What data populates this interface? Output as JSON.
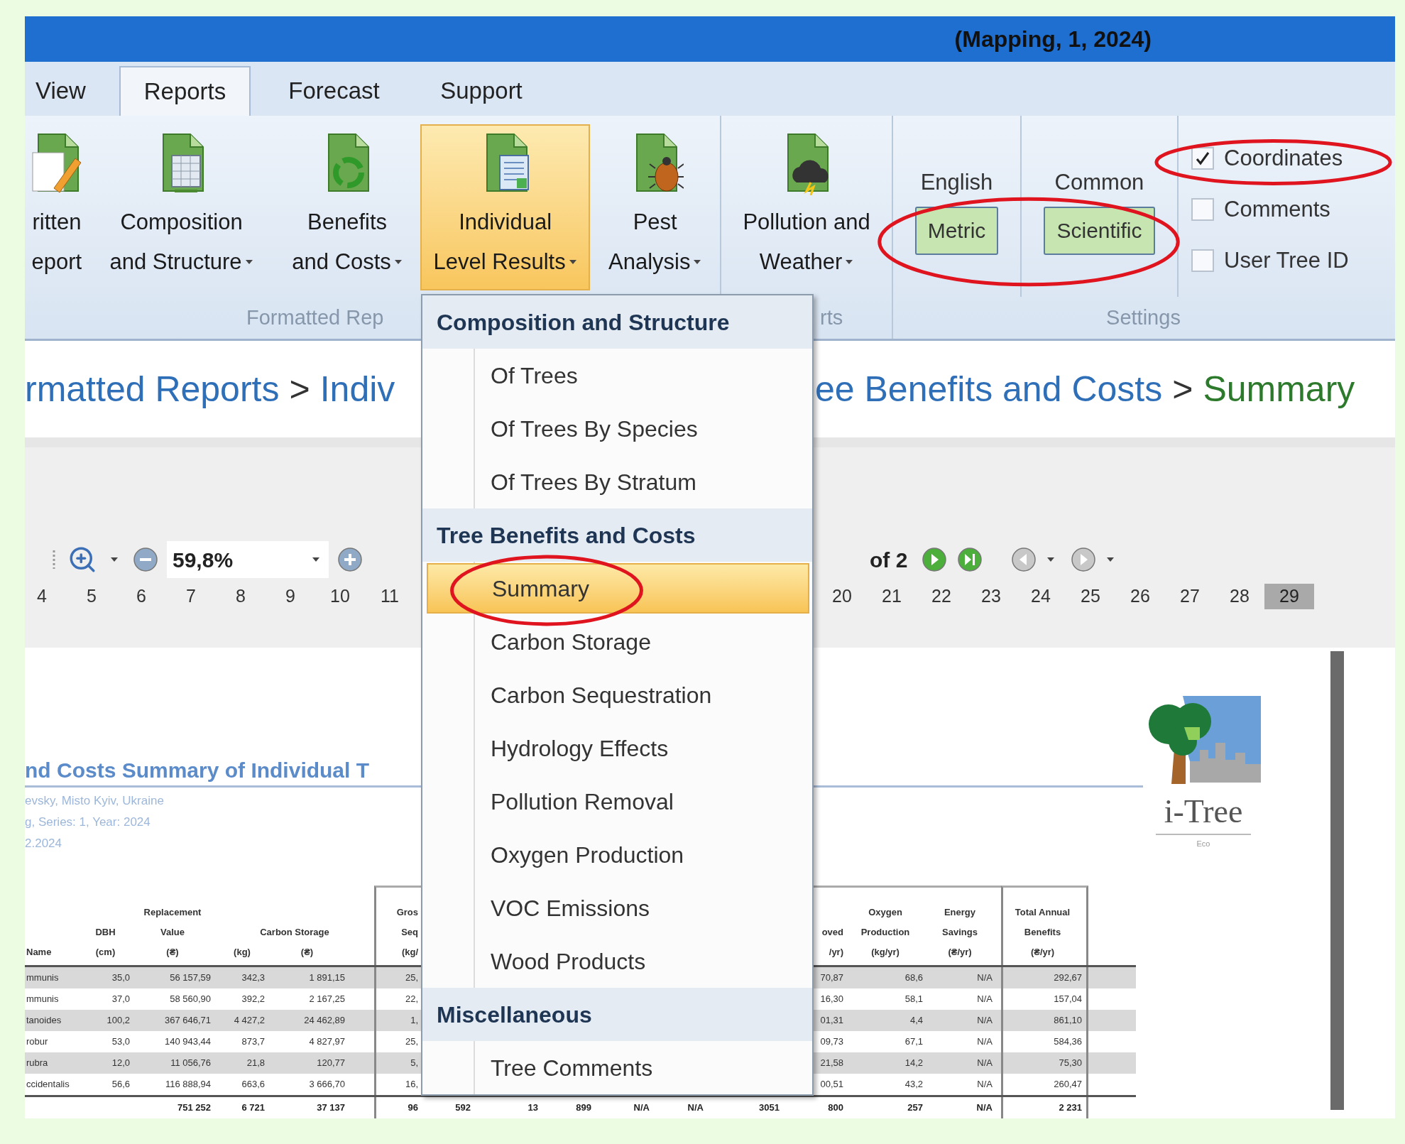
{
  "window": {
    "title": "(Mapping, 1, 2024)"
  },
  "tabs": [
    {
      "label": "View",
      "selected": false
    },
    {
      "label": "Reports",
      "selected": true
    },
    {
      "label": "Forecast",
      "selected": false
    },
    {
      "label": "Support",
      "selected": false
    }
  ],
  "ribbon": {
    "groups": [
      {
        "label": "Formatted Rep",
        "buttons": [
          {
            "lines": [
              "ritten",
              "eport"
            ],
            "dropdown": false,
            "selected": false
          },
          {
            "lines": [
              "Composition",
              "and Structure"
            ],
            "dropdown": true,
            "selected": false
          },
          {
            "lines": [
              "Benefits",
              "and Costs"
            ],
            "dropdown": true,
            "selected": false
          },
          {
            "lines": [
              "Individual",
              "Level Results"
            ],
            "dropdown": true,
            "selected": true
          },
          {
            "lines": [
              "Pest",
              "Analysis"
            ],
            "dropdown": true,
            "selected": false
          }
        ]
      },
      {
        "label": "rts",
        "buttons": [
          {
            "lines": [
              "Pollution and",
              "Weather"
            ],
            "dropdown": true,
            "selected": false
          }
        ]
      }
    ],
    "settings": {
      "label": "Settings",
      "toggles": [
        {
          "caption": "English",
          "option": "Metric",
          "selected": true
        },
        {
          "caption": "Common",
          "option": "Scientific",
          "selected": true
        }
      ],
      "checkboxes": [
        {
          "label": "Coordinates",
          "checked": true
        },
        {
          "label": "Comments",
          "checked": false
        },
        {
          "label": "User Tree ID",
          "checked": false
        }
      ]
    }
  },
  "breadcrumb": {
    "separator": ">",
    "start": [
      {
        "text": "rmatted Reports",
        "selected": false
      },
      {
        "text": "Indiv",
        "selected": false
      }
    ],
    "end": [
      {
        "text": "ee Benefits and Costs",
        "selected": false
      },
      {
        "text": "Summary",
        "selected": true
      }
    ]
  },
  "viewer": {
    "zoom": "59,8%",
    "page_count": "of 2",
    "pages_start": [
      {
        "label": "4",
        "selected": false
      },
      {
        "label": "5",
        "selected": false
      },
      {
        "label": "6",
        "selected": false
      },
      {
        "label": "7",
        "selected": false
      },
      {
        "label": "8",
        "selected": false
      },
      {
        "label": "9",
        "selected": false
      },
      {
        "label": "10",
        "selected": false
      },
      {
        "label": "11",
        "selected": false
      }
    ],
    "pages_end": [
      {
        "label": "20",
        "selected": false
      },
      {
        "label": "21",
        "selected": false
      },
      {
        "label": "22",
        "selected": false
      },
      {
        "label": "23",
        "selected": false
      },
      {
        "label": "24",
        "selected": false
      },
      {
        "label": "25",
        "selected": false
      },
      {
        "label": "26",
        "selected": false
      },
      {
        "label": "27",
        "selected": false
      },
      {
        "label": "28",
        "selected": false
      },
      {
        "label": "29",
        "selected": true
      }
    ]
  },
  "report": {
    "title": "nd Costs Summary of Individual T",
    "subtitle_lines": [
      "evsky, Misto Kyiv, Ukraine",
      "g, Series: 1, Year: 2024",
      "2.2024"
    ],
    "table": {
      "columns": [
        {
          "kind": "name",
          "lines": [
            "Name"
          ]
        },
        {
          "kind": "number",
          "lines": [
            "DBH",
            "(cm)"
          ]
        },
        {
          "kind": "number",
          "lines": [
            "Replacement",
            "Value",
            "(₴)"
          ]
        },
        {
          "kind": "number",
          "group": "Carbon Storage",
          "lines": [
            "(kg)"
          ]
        },
        {
          "kind": "number",
          "lines": [
            "(₴)"
          ]
        },
        {
          "kind": "number",
          "lines": [
            "Gros",
            "Seq",
            "(kg/"
          ]
        },
        {
          "kind": "covered"
        },
        {
          "kind": "covered"
        },
        {
          "kind": "covered"
        },
        {
          "kind": "covered"
        },
        {
          "kind": "covered"
        },
        {
          "kind": "covered"
        },
        {
          "kind": "number",
          "lines": [
            "oved",
            "/yr)"
          ]
        },
        {
          "kind": "number",
          "lines": [
            "Oxygen",
            "Production",
            "(kg/yr)"
          ]
        },
        {
          "kind": "number",
          "lines": [
            "Energy",
            "Savings",
            "(₴/yr)"
          ]
        },
        {
          "kind": "number",
          "lines": [
            "Total Annual",
            "Benefits",
            "(₴/yr)"
          ]
        }
      ],
      "rows": [
        [
          "mmunis",
          "35,0",
          "56 157,59",
          "342,3",
          "1 891,15",
          "25,",
          "70,87",
          "68,6",
          "N/A",
          "292,67"
        ],
        [
          "mmunis",
          "37,0",
          "58 560,90",
          "392,2",
          "2 167,25",
          "22,",
          "16,30",
          "58,1",
          "N/A",
          "157,04"
        ],
        [
          "tanoides",
          "100,2",
          "367 646,71",
          "4 427,2",
          "24 462,89",
          "1,",
          "01,31",
          "4,4",
          "N/A",
          "861,10"
        ],
        [
          "robur",
          "53,0",
          "140 943,44",
          "873,7",
          "4 827,97",
          "25,",
          "09,73",
          "67,1",
          "N/A",
          "584,36"
        ],
        [
          "rubra",
          "12,0",
          "11 056,76",
          "21,8",
          "120,77",
          "5,",
          "21,58",
          "14,2",
          "N/A",
          "75,30"
        ],
        [
          "ccidentalis",
          "56,6",
          "116 888,94",
          "663,6",
          "3 666,70",
          "16,",
          "00,51",
          "43,2",
          "N/A",
          "260,47"
        ]
      ],
      "totals": [
        "751 252",
        "6 721",
        "37 137",
        "96",
        "592",
        "13",
        "899",
        "N/A",
        "N/A",
        "3051",
        "800",
        "257",
        "N/A",
        "2 231"
      ]
    },
    "logo": {
      "name": "i-Tree",
      "sub": "Eco"
    }
  },
  "menu": {
    "sections": [
      {
        "heading": "Composition and Structure",
        "items": [
          {
            "label": "Of Trees",
            "selected": false
          },
          {
            "label": "Of Trees By Species",
            "selected": false
          },
          {
            "label": "Of Trees By Stratum",
            "selected": false
          }
        ]
      },
      {
        "heading": "Tree Benefits and Costs",
        "items": [
          {
            "label": "Summary",
            "selected": true
          },
          {
            "label": "Carbon Storage",
            "selected": false
          },
          {
            "label": "Carbon Sequestration",
            "selected": false
          },
          {
            "label": "Hydrology Effects",
            "selected": false
          },
          {
            "label": "Pollution Removal",
            "selected": false
          },
          {
            "label": "Oxygen Production",
            "selected": false
          },
          {
            "label": "VOC Emissions",
            "selected": false
          },
          {
            "label": "Wood Products",
            "selected": false
          }
        ]
      },
      {
        "heading": "Miscellaneous",
        "items": [
          {
            "label": "Tree Comments",
            "selected": false
          }
        ]
      }
    ]
  }
}
